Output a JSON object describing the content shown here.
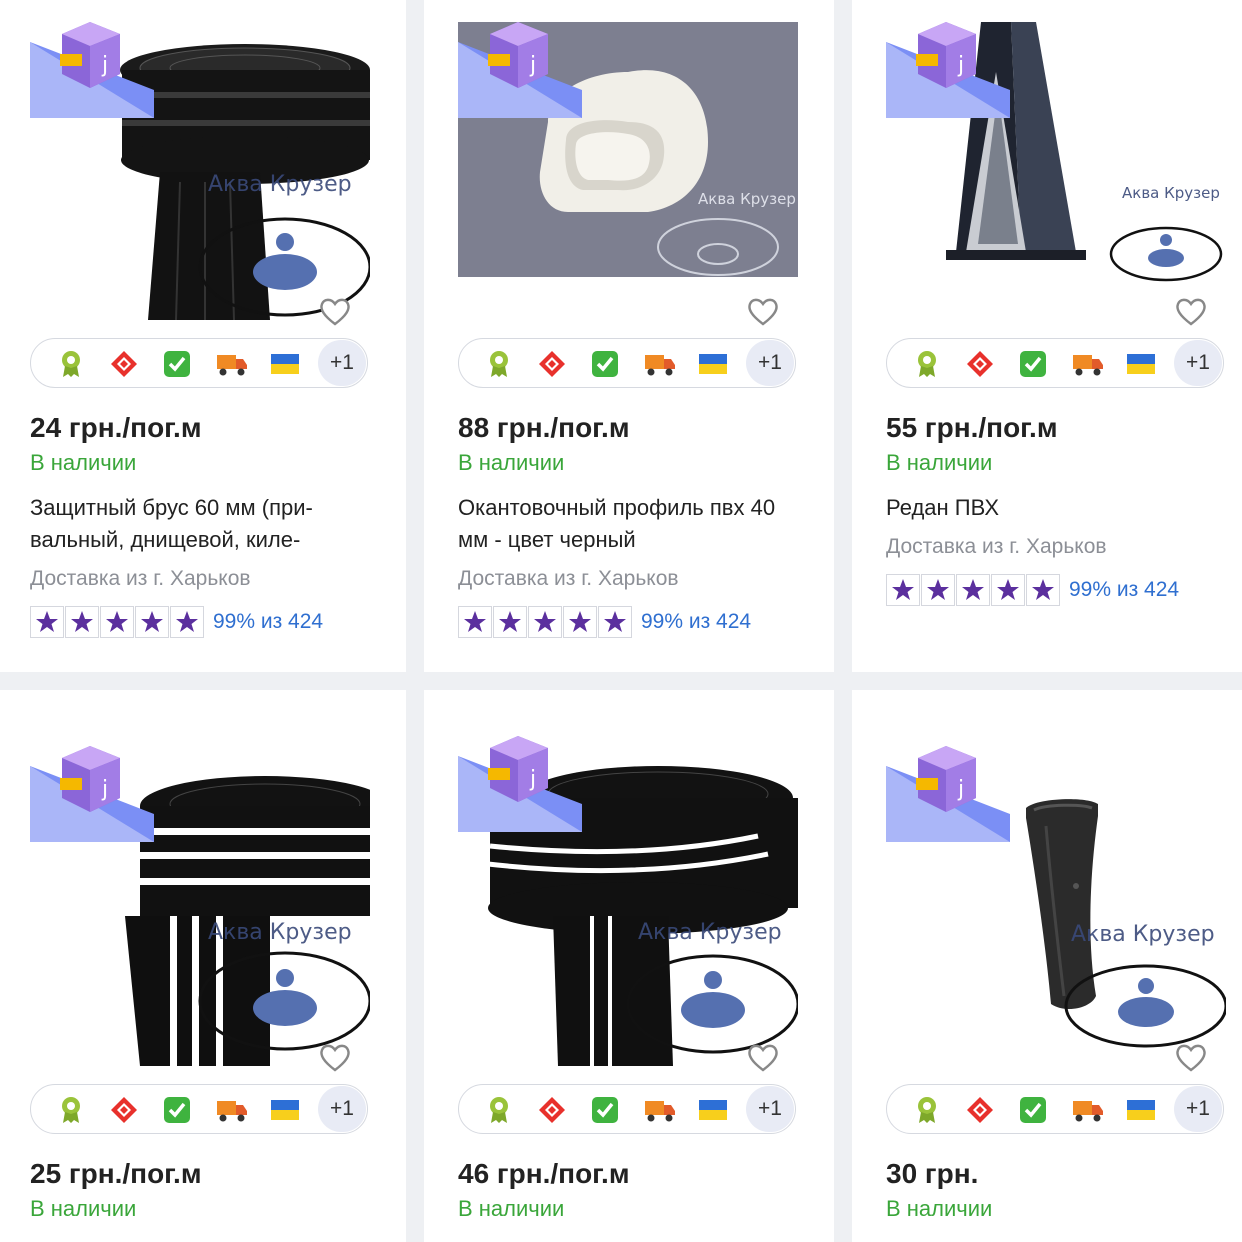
{
  "colors": {
    "in_stock": "#3aa63a",
    "rating_link": "#2f6fd0",
    "star": "#5b2f9e",
    "watermark": "#3a4a7a"
  },
  "chips_icons": [
    "quality-rosette-icon",
    "nova-poshta-icon",
    "check-mark-icon",
    "delivery-truck-icon",
    "ukraine-flag-icon"
  ],
  "products": [
    {
      "price": "24 грн./пог.м",
      "stock": "В наличии",
      "title": "Защитный брус 60 мм (при-вальный, днищевой, киле-",
      "delivery": "Доставка из г. Харьков",
      "rating_text": "99% из 424",
      "chips_more": "+1",
      "watermark": "Аква Крузер"
    },
    {
      "price": "88 грн./пог.м",
      "stock": "В наличии",
      "title": "Окантовочный профиль пвх 40 мм - цвет черный",
      "delivery": "Доставка из г. Харьков",
      "rating_text": "99% из 424",
      "chips_more": "+1",
      "watermark": "Аква Крузер"
    },
    {
      "price": "55 грн./пог.м",
      "stock": "В наличии",
      "title": "Редан ПВХ",
      "delivery": "Доставка из г. Харьков",
      "rating_text": "99% из 424",
      "chips_more": "+1",
      "watermark": "Аква Крузер"
    },
    {
      "price": "25 грн./пог.м",
      "stock": "В наличии",
      "chips_more": "+1",
      "watermark": "Аква Крузер"
    },
    {
      "price": "46 грн./пог.м",
      "stock": "В наличии",
      "chips_more": "+1",
      "watermark": "Аква Крузер"
    },
    {
      "price": "30 грн.",
      "stock": "В наличии",
      "chips_more": "+1",
      "watermark": "Аква Крузер"
    }
  ]
}
